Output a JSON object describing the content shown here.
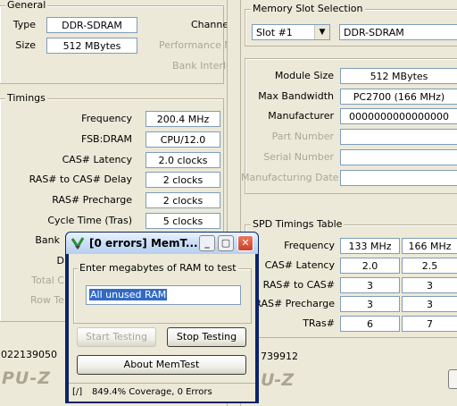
{
  "cpuz_left": {
    "general": {
      "title": "General",
      "type_label": "Type",
      "type_value": "DDR-SDRAM",
      "size_label": "Size",
      "size_value": "512 MBytes",
      "channels_label": "Channe",
      "perf_label": "Performance M",
      "bank_label": "Bank Interle"
    },
    "timings": {
      "title": "Timings",
      "rows": [
        {
          "label": "Frequency",
          "value": "200.4 MHz"
        },
        {
          "label": "FSB:DRAM",
          "value": "CPU/12.0"
        },
        {
          "label": "CAS# Latency",
          "value": "2.0 clocks"
        },
        {
          "label": "RAS# to CAS# Delay",
          "value": "2 clocks"
        },
        {
          "label": "RAS# Precharge",
          "value": "2 clocks"
        },
        {
          "label": "Cycle Time (Tras)",
          "value": "5 clocks"
        }
      ],
      "bank_partial": "Bank",
      "d_partial": "D",
      "total_partial": "Total C",
      "row_partial": "Row Te"
    },
    "status_number": "022139050",
    "logo": "PU-Z"
  },
  "cpuz_right": {
    "slot_selection": {
      "title": "Memory Slot Selection",
      "slot_value": "Slot #1",
      "slot_type": "DDR-SDRAM"
    },
    "info": [
      {
        "label": "Module Size",
        "value": "512 MBytes",
        "dim": false
      },
      {
        "label": "Max Bandwidth",
        "value": "PC2700 (166 MHz)",
        "dim": false
      },
      {
        "label": "Manufacturer",
        "value": "0000000000000000",
        "dim": false
      },
      {
        "label": "Part Number",
        "value": "",
        "dim": true
      },
      {
        "label": "Serial Number",
        "value": "",
        "dim": true
      },
      {
        "label": "Manufacturing Date",
        "value": "",
        "dim": true
      }
    ],
    "spd": {
      "title": "SPD Timings Table",
      "header": {
        "label": "Frequency",
        "col1": "133 MHz",
        "col2": "166 MHz"
      },
      "rows": [
        {
          "label": "CAS# Latency",
          "col1": "2.0",
          "col2": "2.5"
        },
        {
          "label": "RAS# to CAS#",
          "col1": "3",
          "col2": "3"
        },
        {
          "label": "RAS# Precharge",
          "col1": "3",
          "col2": "3"
        },
        {
          "label": "TRas#",
          "col1": "6",
          "col2": "7"
        }
      ]
    },
    "status_number": "739912",
    "logo": "U-Z"
  },
  "memtest": {
    "title": "[0 errors] MemT...",
    "group_title": "Enter megabytes of RAM to test",
    "input_value": "All unused RAM",
    "start_button": "Start Testing",
    "stop_button": "Stop Testing",
    "about_button": "About MemTest",
    "status_spinner": "[/]",
    "status_text": "849.4% Coverage, 0 Errors"
  }
}
